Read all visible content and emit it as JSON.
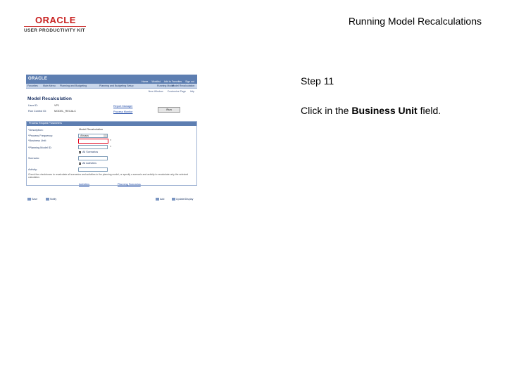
{
  "header": {
    "logo_brand": "ORACLE",
    "logo_product": "USER PRODUCTIVITY KIT",
    "slide_title": "Running Model Recalculations"
  },
  "step": {
    "title": "Step 11",
    "instruction_prefix": "Click in the ",
    "instruction_target": "Business Unit",
    "instruction_suffix": " field."
  },
  "screenshot": {
    "brand": "ORACLE",
    "top_links": [
      "Home",
      "Worklist",
      "Add to Favorites",
      "Sign out"
    ],
    "nav": [
      "Favorites",
      "Main Menu",
      "Planning and Budgeting",
      "Planning and Budgeting Setup",
      "Running Model",
      "Model Recalculation"
    ],
    "toolbar": [
      "New Window",
      "Customize Page",
      "http"
    ],
    "page_title": "Model Recalculation",
    "user_id_label": "User ID:",
    "user_id_value": "VP1",
    "run_control_label": "Run Control ID:",
    "run_control_value": "MODEL_RECALC",
    "report_manager_link": "Report Manager",
    "process_monitor_link": "Process Monitor",
    "run_button": "Run",
    "panel_title": "Process Request Parameters",
    "description_label": "*Description:",
    "description_value": "Model Recalculation",
    "process_frequency_label": "*Process Frequency:",
    "process_frequency_value": "Always",
    "business_unit_label": "*Business Unit:",
    "planning_model_label": "*Planning Model ID:",
    "all_scenarios_label": "All Scenarios",
    "scenario_label": "Scenario:",
    "all_activities_label": "All Activities",
    "activity_label": "Activity:",
    "description_text": "Check the checkboxes to recalculate all scenarios and activities in the planning model, or specify a scenario and activity to recalculate only the selected calculation.",
    "activities_link": "Activities",
    "scenarios_link": "Planning Scenarios",
    "save_button": "Save",
    "notify_button": "Notify",
    "add_button": "Add",
    "update_button": "Update/Display"
  }
}
